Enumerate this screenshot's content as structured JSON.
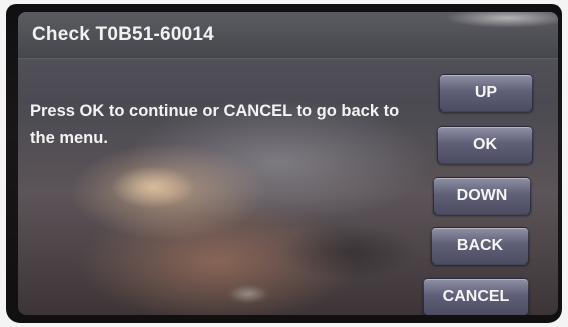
{
  "header": {
    "title": "Check T0B51-60014"
  },
  "message": {
    "text": "Press OK to continue or CANCEL to go back to the menu."
  },
  "buttons": {
    "up": "UP",
    "ok": "OK",
    "down": "DOWN",
    "back": "BACK",
    "cancel": "CANCEL"
  },
  "colors": {
    "screen_background": "#4b4a52",
    "button_fill": "#5f6077",
    "text": "#f3f3f3"
  }
}
